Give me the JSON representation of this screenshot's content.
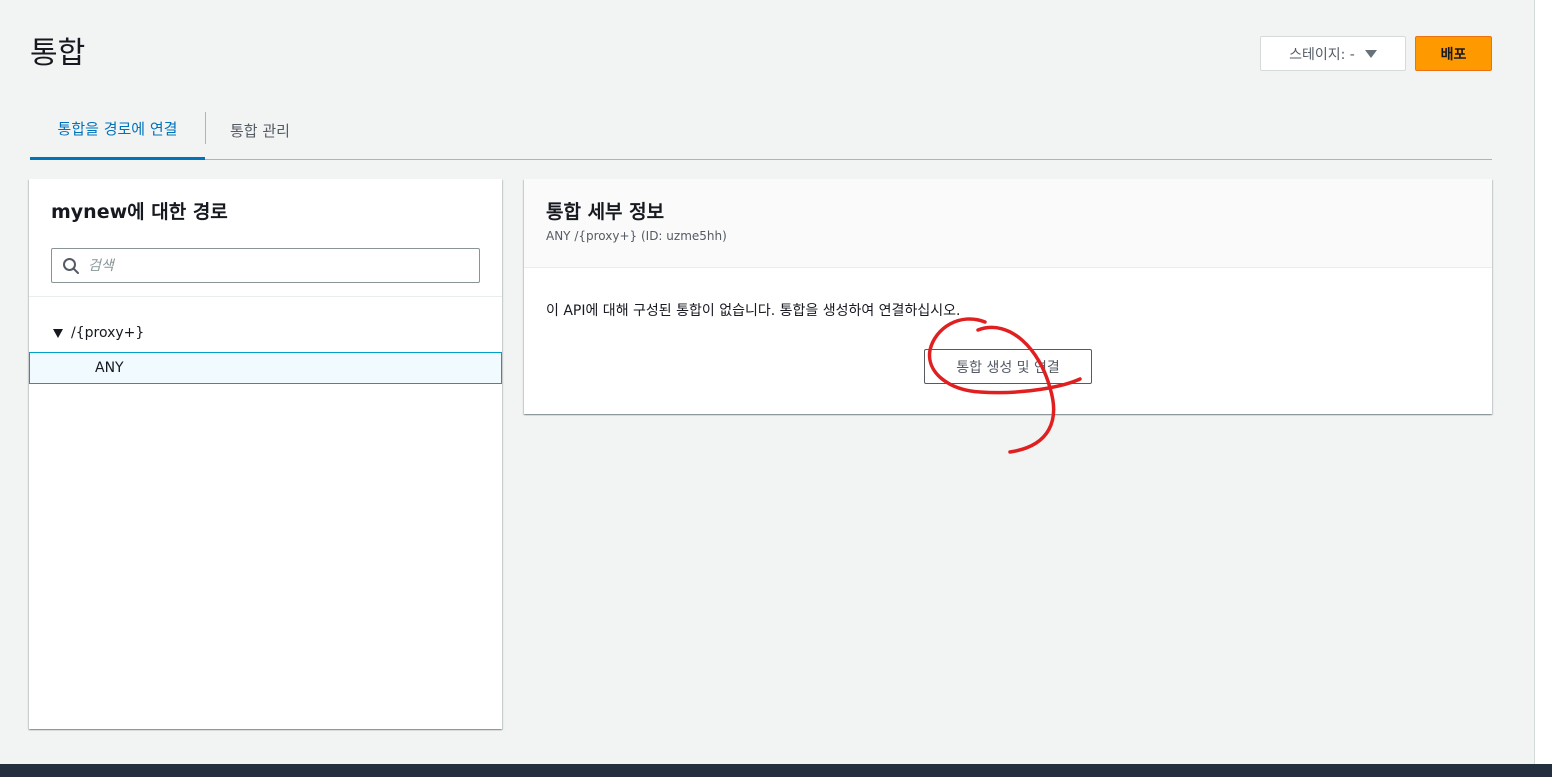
{
  "page": {
    "title": "통합"
  },
  "header": {
    "stage_label": "스테이지: -",
    "deploy_label": "배포"
  },
  "tabs": [
    {
      "label": "통합을 경로에 연결",
      "selected": true
    },
    {
      "label": "통합 관리",
      "selected": false
    }
  ],
  "routes_panel": {
    "title": "mynew에 대한 경로",
    "search_placeholder": "검색",
    "tree": {
      "path": "/{proxy+}",
      "expanded": true,
      "children": [
        {
          "label": "ANY",
          "selected": true
        }
      ]
    }
  },
  "details_panel": {
    "title": "통합 세부 정보",
    "subtitle": "ANY /{proxy+} (ID: uzme5hh)",
    "empty_message": "이 API에 대해 구성된 통합이 없습니다. 통합을 생성하여 연결하십시오.",
    "create_button": "통합 생성 및 연결"
  },
  "colors": {
    "accent": "#0073bb",
    "primary_button": "#ff9900",
    "annotation": "#e02020",
    "background": "#f2f3f3"
  }
}
